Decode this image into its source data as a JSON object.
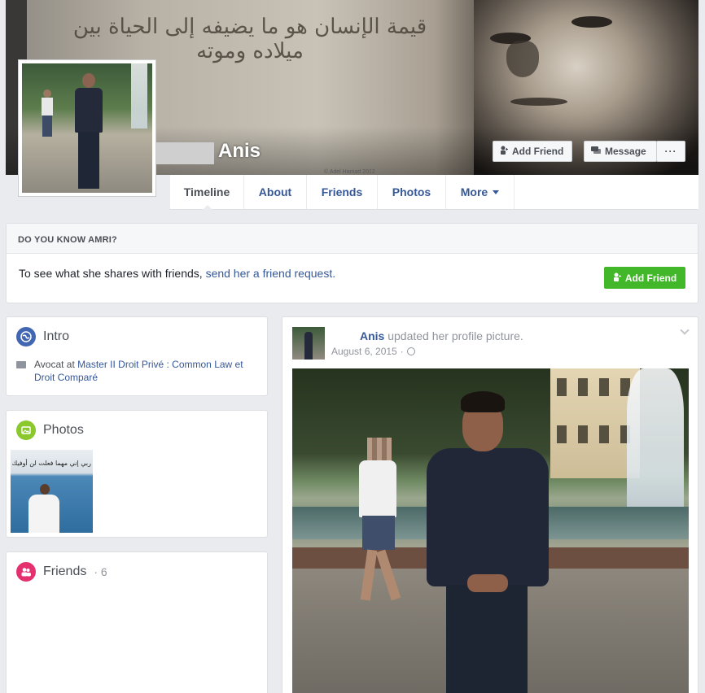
{
  "cover": {
    "calligraphy": "قيمة الإنسان هو ما يضيفه إلى الحياة بين ميلاده وموته",
    "credit": "© Adel Hamad 2012"
  },
  "profile": {
    "name": "Anis",
    "add_friend_label": "Add Friend",
    "message_label": "Message",
    "more_label": "···"
  },
  "nav": {
    "tabs": [
      {
        "label": "Timeline",
        "active": true
      },
      {
        "label": "About"
      },
      {
        "label": "Friends"
      },
      {
        "label": "Photos"
      },
      {
        "label": "More"
      }
    ]
  },
  "know": {
    "heading": "DO YOU KNOW AMRI?",
    "text": "To see what she shares with friends, ",
    "link": "send her a friend request.",
    "button_label": "Add Friend"
  },
  "intro": {
    "title": "Intro",
    "work_prefix": "Avocat at ",
    "work_place": "Master II Droit Privé : Common Law et Droit Comparé"
  },
  "photos": {
    "title": "Photos",
    "thumb_text": "ربي إني مهما فعلت لن أوفيك حقك ♥"
  },
  "friends": {
    "title": "Friends",
    "count_text": "· 6"
  },
  "post": {
    "name": "Anis",
    "action": " updated her profile picture.",
    "date": "August 6, 2015",
    "separator": "·"
  },
  "colors": {
    "link": "#365899",
    "green": "#42b72a",
    "intro_icon": "#4267b2",
    "photos_icon": "#8ac82d",
    "friends_icon": "#e4306f"
  },
  "icons": {
    "add_friend": "person-plus-icon",
    "message": "chat-icon",
    "intro": "globe-icon",
    "photos": "photo-icon",
    "friends": "people-icon",
    "work": "briefcase-icon",
    "privacy": "globe-icon"
  }
}
